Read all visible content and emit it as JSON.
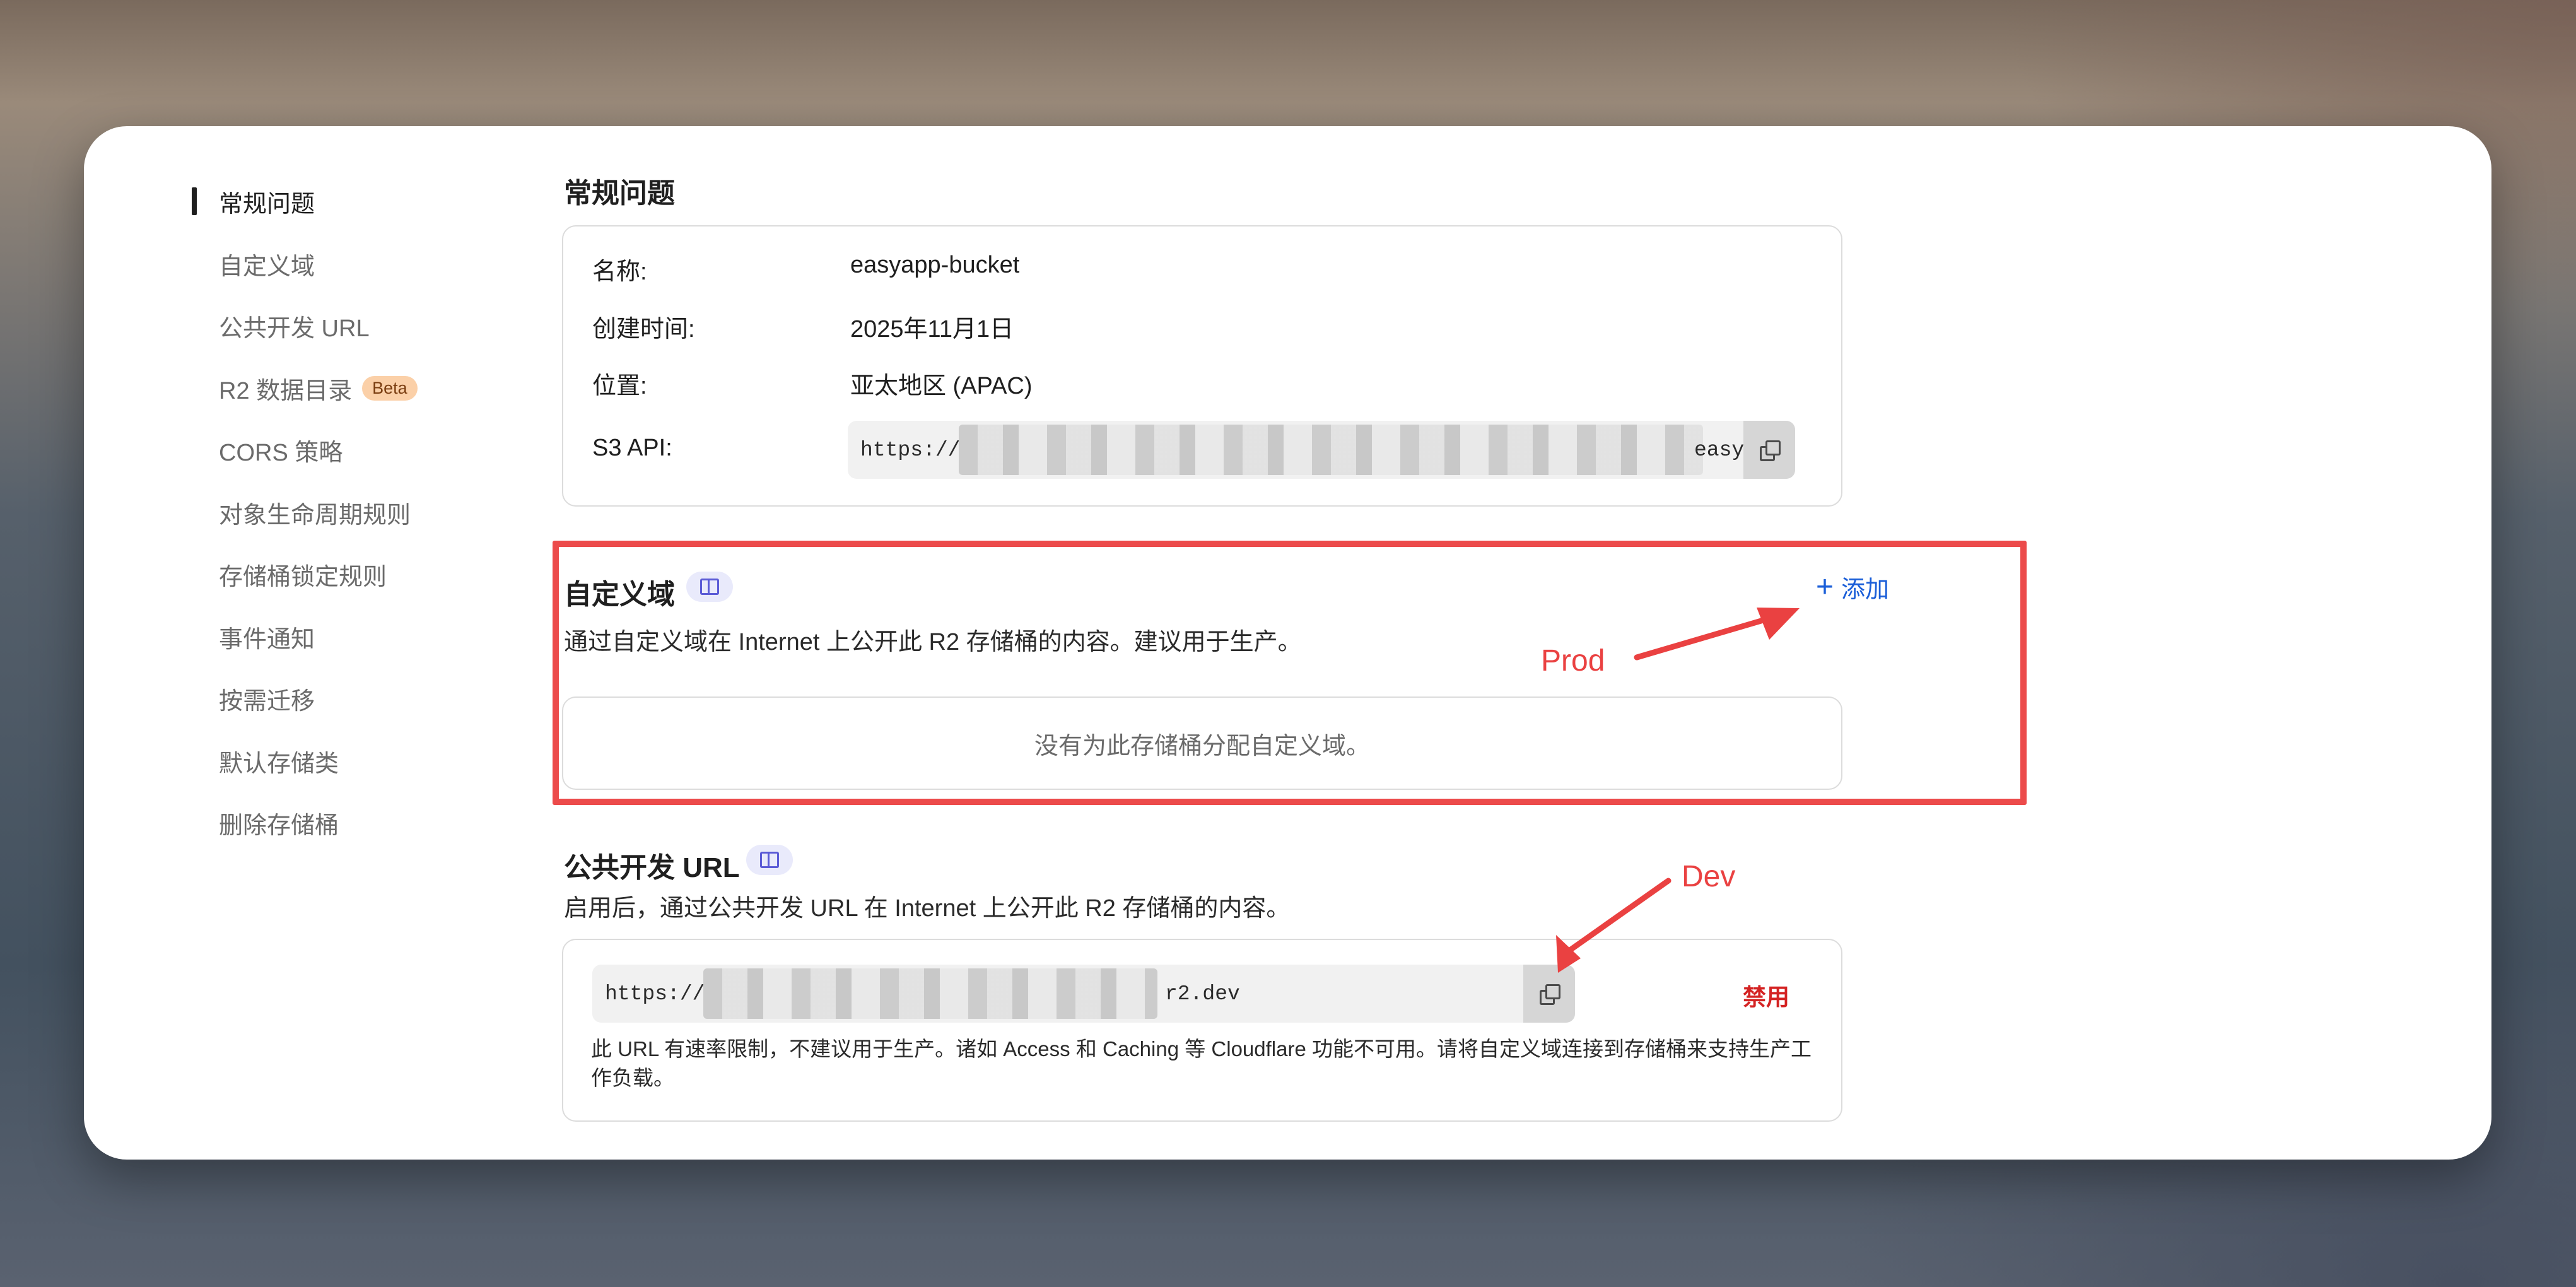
{
  "sidebar": {
    "items": [
      {
        "label": "常规问题"
      },
      {
        "label": "自定义域"
      },
      {
        "label": "公共开发 URL"
      },
      {
        "label": "R2 数据目录",
        "badge": "Beta"
      },
      {
        "label": "CORS 策略"
      },
      {
        "label": "对象生命周期规则"
      },
      {
        "label": "存储桶锁定规则"
      },
      {
        "label": "事件通知"
      },
      {
        "label": "按需迁移"
      },
      {
        "label": "默认存储类"
      },
      {
        "label": "删除存储桶"
      }
    ],
    "active_index": 0
  },
  "general": {
    "title": "常规问题",
    "name_label": "名称:",
    "name_value": "easyapp-bucket",
    "created_label": "创建时间:",
    "created_value": "2025年11月1日",
    "location_label": "位置:",
    "location_value": "亚太地区 (APAC)",
    "s3_label": "S3 API:",
    "s3_prefix": "https://",
    "s3_suffix": "easya"
  },
  "custom_domain": {
    "title": "自定义域",
    "add_label": "添加",
    "description": "通过自定义域在 Internet 上公开此 R2 存储桶的内容。建议用于生产。",
    "empty_text": "没有为此存储桶分配自定义域。"
  },
  "public_dev_url": {
    "title": "公共开发 URL",
    "description": "启用后，通过公共开发 URL 在 Internet 上公开此 R2 存储桶的内容。",
    "url_prefix": "https://",
    "url_suffix": "r2.dev",
    "disable_label": "禁用",
    "note": "此 URL 有速率限制，不建议用于生产。诸如 Access 和 Caching 等 Cloudflare 功能不可用。请将自定义域连接到存储桶来支持生产工作负载。"
  },
  "annotations": {
    "prod": "Prod",
    "dev": "Dev",
    "color": "#ea4141"
  },
  "colors": {
    "link": "#1a5ed8",
    "danger": "#d42222",
    "badge_bg": "#fbd0a8"
  }
}
